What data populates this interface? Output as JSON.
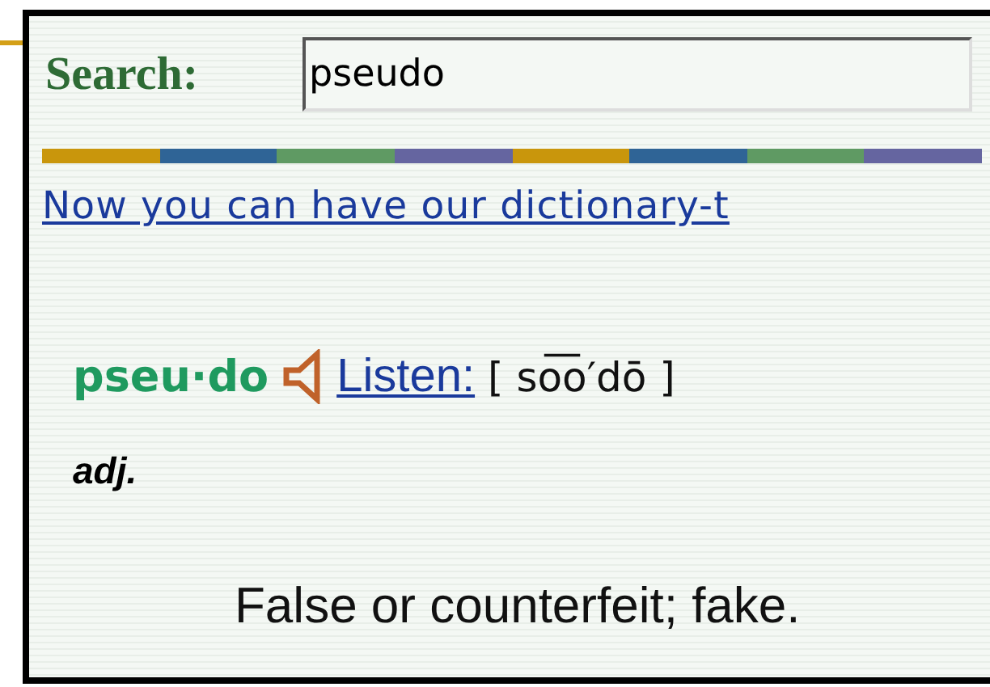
{
  "search": {
    "label": "Search:",
    "value": "pseudo"
  },
  "stripe": [
    {
      "color": "#c9960c"
    },
    {
      "color": "#2f6496"
    },
    {
      "color": "#5f9a63"
    },
    {
      "color": "#6565a0"
    },
    {
      "color": "#c9960c"
    },
    {
      "color": "#2f6496"
    },
    {
      "color": "#5f9a63"
    },
    {
      "color": "#6565a0"
    }
  ],
  "promo_link": "Now you can have our dictionary-t",
  "entry": {
    "headword": "pseu·do",
    "listen_link": "Listen:",
    "pronunciation": "[ so͞o′dō ]",
    "part_of_speech": "adj.",
    "definition": "False or counterfeit; fake."
  }
}
